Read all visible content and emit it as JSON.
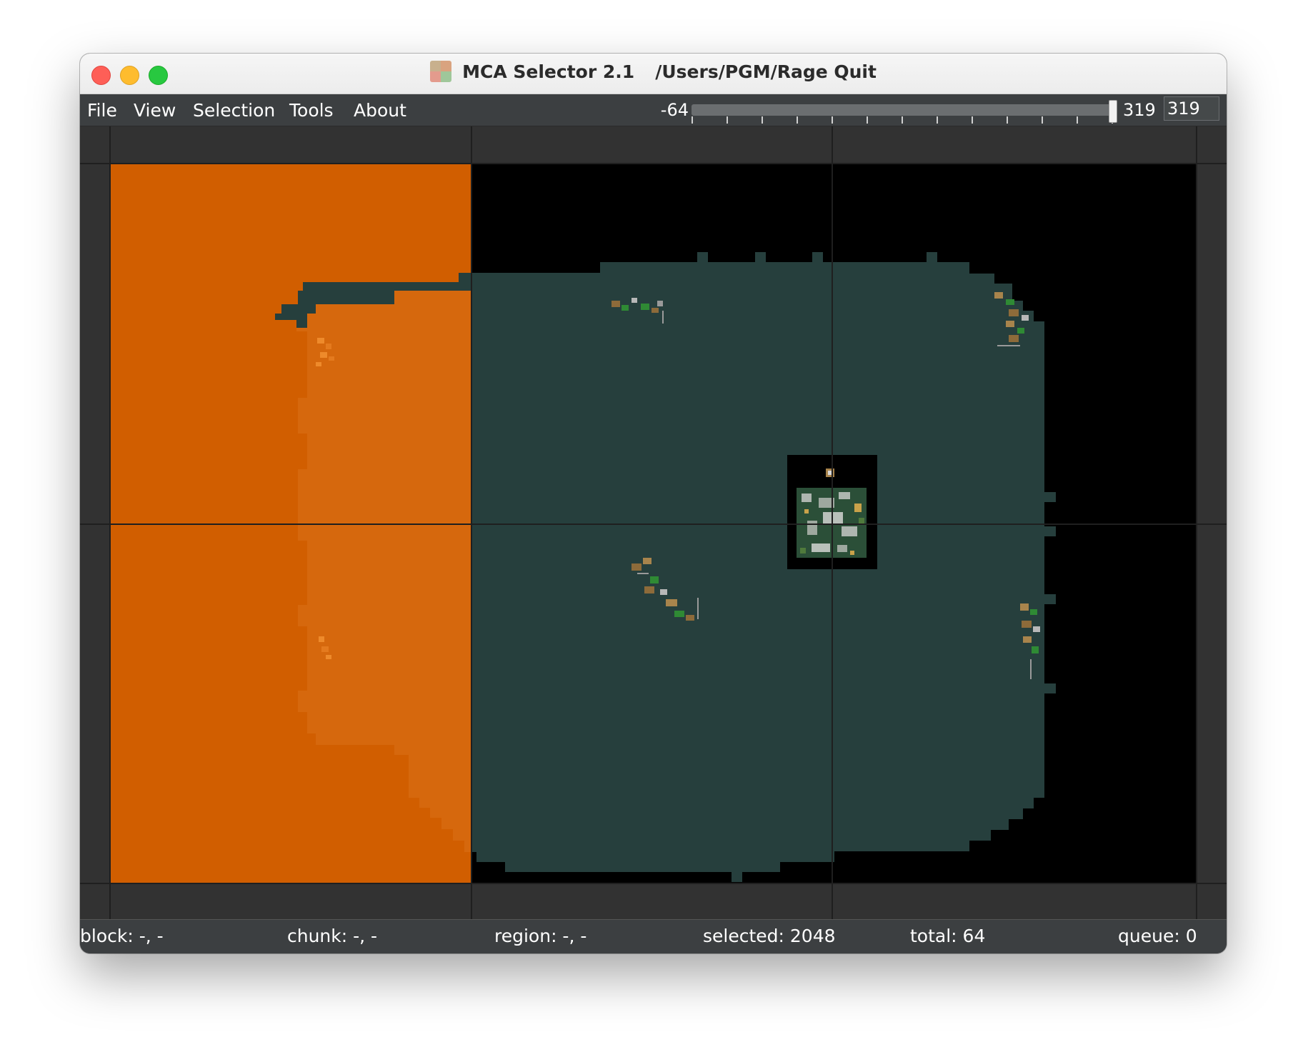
{
  "window": {
    "app_title": "MCA Selector 2.1",
    "path": "/Users/PGM/Rage Quit"
  },
  "menu": {
    "items": [
      "File",
      "View",
      "Selection",
      "Tools",
      "About"
    ]
  },
  "height_slider": {
    "min_label": "-64",
    "max_label": "319",
    "input_value": "319",
    "value_fraction": 1.0
  },
  "map": {
    "colors": {
      "background": "#000000",
      "terrain": "#263f3d",
      "selection_overlay": "#d15e00",
      "selection_over_terrain": "#d6680d",
      "grid_line": "#1f1f1f",
      "border_strip": "#323232"
    }
  },
  "status": {
    "block": "block: -, -",
    "chunk": "chunk: -, -",
    "region": "region: -, -",
    "selected": "selected: 2048",
    "total": "total: 64",
    "queue": "queue: 0"
  }
}
